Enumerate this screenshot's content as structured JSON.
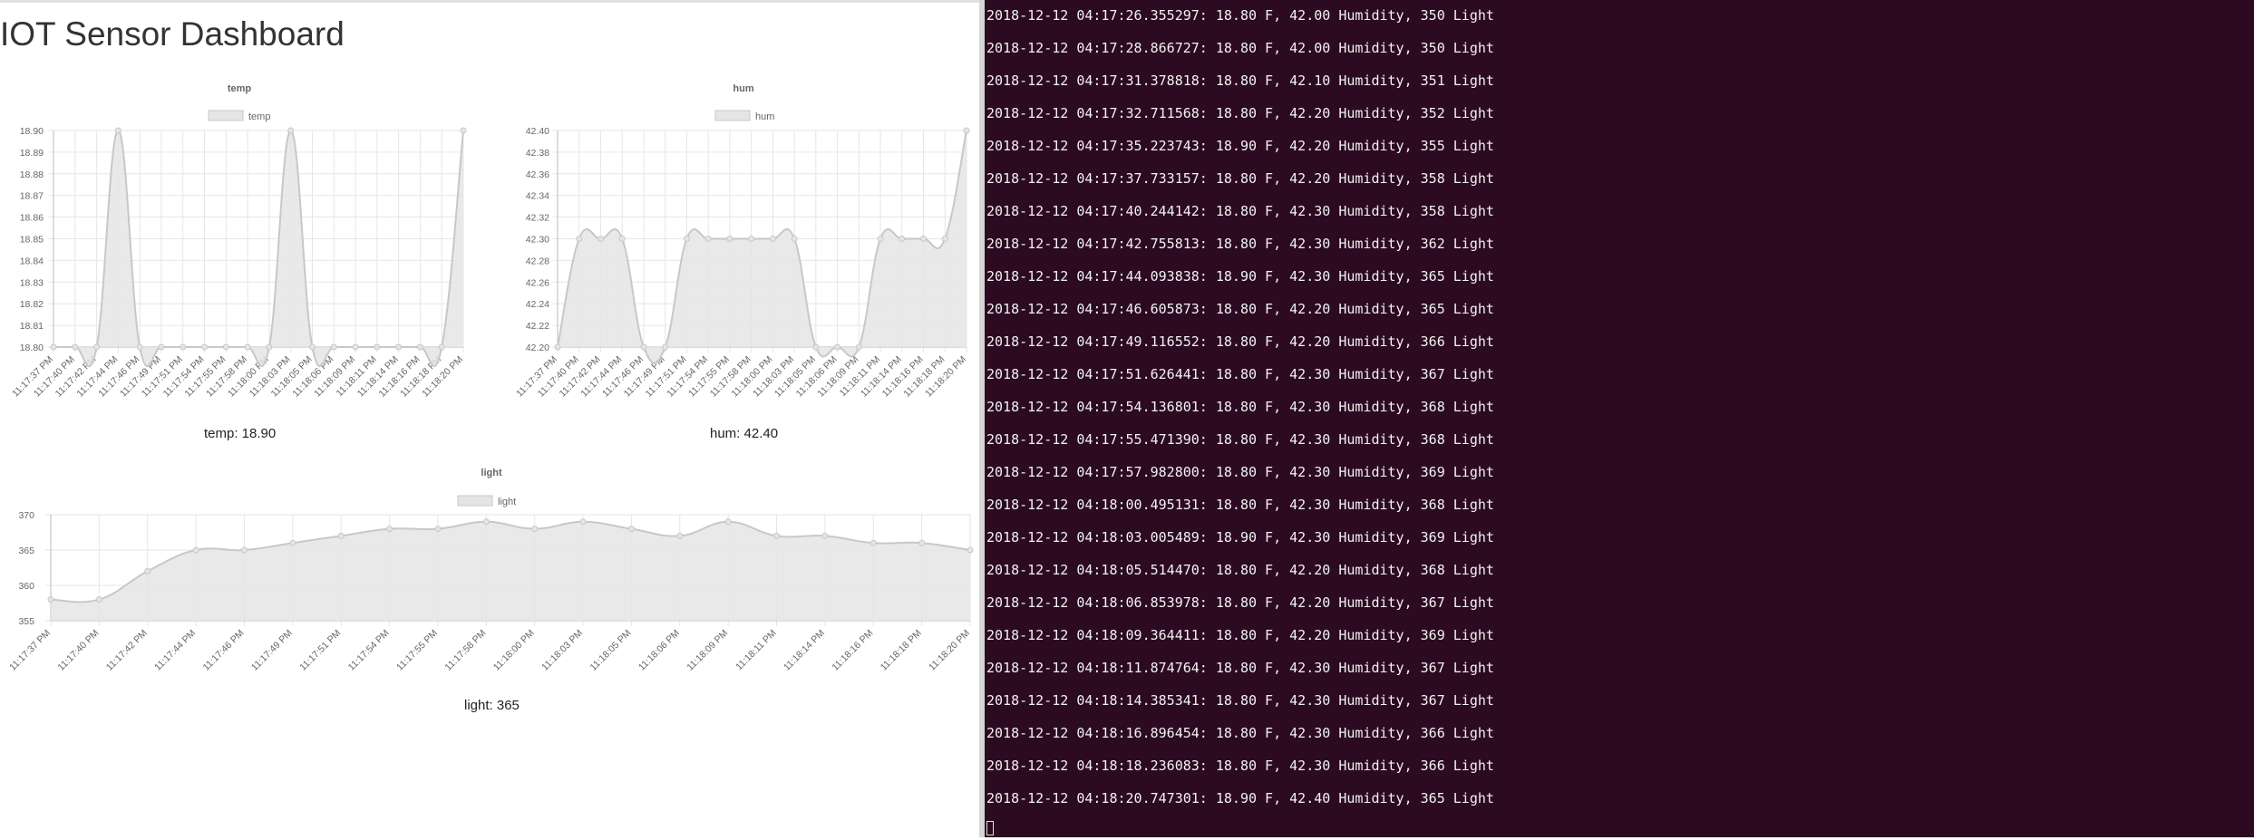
{
  "dashboard": {
    "title": "IOT Sensor Dashboard",
    "readouts": {
      "temp": "temp: 18.90",
      "hum": "hum: 42.40",
      "light": "light: 365"
    }
  },
  "chart_data": [
    {
      "id": "temp",
      "type": "area",
      "title": "temp",
      "legend": "temp",
      "x": [
        "11:17:37 PM",
        "11:17:40 PM",
        "11:17:42 PM",
        "11:17:44 PM",
        "11:17:46 PM",
        "11:17:49 PM",
        "11:17:51 PM",
        "11:17:54 PM",
        "11:17:55 PM",
        "11:17:58 PM",
        "11:18:00 PM",
        "11:18:03 PM",
        "11:18:05 PM",
        "11:18:06 PM",
        "11:18:09 PM",
        "11:18:11 PM",
        "11:18:14 PM",
        "11:18:16 PM",
        "11:18:18 PM",
        "11:18:20 PM"
      ],
      "values": [
        18.8,
        18.8,
        18.8,
        18.9,
        18.8,
        18.8,
        18.8,
        18.8,
        18.8,
        18.8,
        18.8,
        18.9,
        18.8,
        18.8,
        18.8,
        18.8,
        18.8,
        18.8,
        18.8,
        18.9
      ],
      "ylim": [
        18.8,
        18.9
      ],
      "yticks": [
        "18.90",
        "18.89",
        "18.88",
        "18.87",
        "18.86",
        "18.85",
        "18.84",
        "18.83",
        "18.82",
        "18.81",
        "18.80"
      ],
      "grid": true,
      "legend_position": "top"
    },
    {
      "id": "hum",
      "type": "area",
      "title": "hum",
      "legend": "hum",
      "x": [
        "11:17:37 PM",
        "11:17:40 PM",
        "11:17:42 PM",
        "11:17:44 PM",
        "11:17:46 PM",
        "11:17:49 PM",
        "11:17:51 PM",
        "11:17:54 PM",
        "11:17:55 PM",
        "11:17:58 PM",
        "11:18:00 PM",
        "11:18:03 PM",
        "11:18:05 PM",
        "11:18:06 PM",
        "11:18:09 PM",
        "11:18:11 PM",
        "11:18:14 PM",
        "11:18:16 PM",
        "11:18:18 PM",
        "11:18:20 PM"
      ],
      "values": [
        42.2,
        42.3,
        42.3,
        42.3,
        42.2,
        42.2,
        42.3,
        42.3,
        42.3,
        42.3,
        42.3,
        42.3,
        42.2,
        42.2,
        42.2,
        42.3,
        42.3,
        42.3,
        42.3,
        42.4
      ],
      "ylim": [
        42.2,
        42.4
      ],
      "yticks": [
        "42.40",
        "42.38",
        "42.36",
        "42.34",
        "42.32",
        "42.30",
        "42.28",
        "42.26",
        "42.24",
        "42.22",
        "42.20"
      ],
      "grid": true,
      "legend_position": "top"
    },
    {
      "id": "light",
      "type": "area",
      "title": "light",
      "legend": "light",
      "x": [
        "11:17:37 PM",
        "11:17:40 PM",
        "11:17:42 PM",
        "11:17:44 PM",
        "11:17:46 PM",
        "11:17:49 PM",
        "11:17:51 PM",
        "11:17:54 PM",
        "11:17:55 PM",
        "11:17:58 PM",
        "11:18:00 PM",
        "11:18:03 PM",
        "11:18:05 PM",
        "11:18:06 PM",
        "11:18:09 PM",
        "11:18:11 PM",
        "11:18:14 PM",
        "11:18:16 PM",
        "11:18:18 PM",
        "11:18:20 PM"
      ],
      "values": [
        358,
        358,
        362,
        365,
        365,
        366,
        367,
        368,
        368,
        369,
        368,
        369,
        368,
        367,
        369,
        367,
        367,
        366,
        366,
        365
      ],
      "ylim": [
        355,
        370
      ],
      "yticks": [
        "370",
        "365",
        "360",
        "355"
      ],
      "grid": true,
      "legend_position": "top"
    }
  ],
  "terminal": {
    "lines": [
      "2018-12-12 04:17:26.355297: 18.80 F, 42.00 Humidity, 350 Light",
      "2018-12-12 04:17:28.866727: 18.80 F, 42.00 Humidity, 350 Light",
      "2018-12-12 04:17:31.378818: 18.80 F, 42.10 Humidity, 351 Light",
      "2018-12-12 04:17:32.711568: 18.80 F, 42.20 Humidity, 352 Light",
      "2018-12-12 04:17:35.223743: 18.90 F, 42.20 Humidity, 355 Light",
      "2018-12-12 04:17:37.733157: 18.80 F, 42.20 Humidity, 358 Light",
      "2018-12-12 04:17:40.244142: 18.80 F, 42.30 Humidity, 358 Light",
      "2018-12-12 04:17:42.755813: 18.80 F, 42.30 Humidity, 362 Light",
      "2018-12-12 04:17:44.093838: 18.90 F, 42.30 Humidity, 365 Light",
      "2018-12-12 04:17:46.605873: 18.80 F, 42.20 Humidity, 365 Light",
      "2018-12-12 04:17:49.116552: 18.80 F, 42.20 Humidity, 366 Light",
      "2018-12-12 04:17:51.626441: 18.80 F, 42.30 Humidity, 367 Light",
      "2018-12-12 04:17:54.136801: 18.80 F, 42.30 Humidity, 368 Light",
      "2018-12-12 04:17:55.471390: 18.80 F, 42.30 Humidity, 368 Light",
      "2018-12-12 04:17:57.982800: 18.80 F, 42.30 Humidity, 369 Light",
      "2018-12-12 04:18:00.495131: 18.80 F, 42.30 Humidity, 368 Light",
      "2018-12-12 04:18:03.005489: 18.90 F, 42.30 Humidity, 369 Light",
      "2018-12-12 04:18:05.514470: 18.80 F, 42.20 Humidity, 368 Light",
      "2018-12-12 04:18:06.853978: 18.80 F, 42.20 Humidity, 367 Light",
      "2018-12-12 04:18:09.364411: 18.80 F, 42.20 Humidity, 369 Light",
      "2018-12-12 04:18:11.874764: 18.80 F, 42.30 Humidity, 367 Light",
      "2018-12-12 04:18:14.385341: 18.80 F, 42.30 Humidity, 367 Light",
      "2018-12-12 04:18:16.896454: 18.80 F, 42.30 Humidity, 366 Light",
      "2018-12-12 04:18:18.236083: 18.80 F, 42.30 Humidity, 366 Light",
      "2018-12-12 04:18:20.747301: 18.90 F, 42.40 Humidity, 365 Light"
    ]
  },
  "colors": {
    "terminal_bg": "#2c0a22",
    "terminal_text": "#f2f2f2",
    "chart_fill": "#e5e5e5",
    "chart_line": "#c8c8c8",
    "grid": "#e6e6e6"
  }
}
